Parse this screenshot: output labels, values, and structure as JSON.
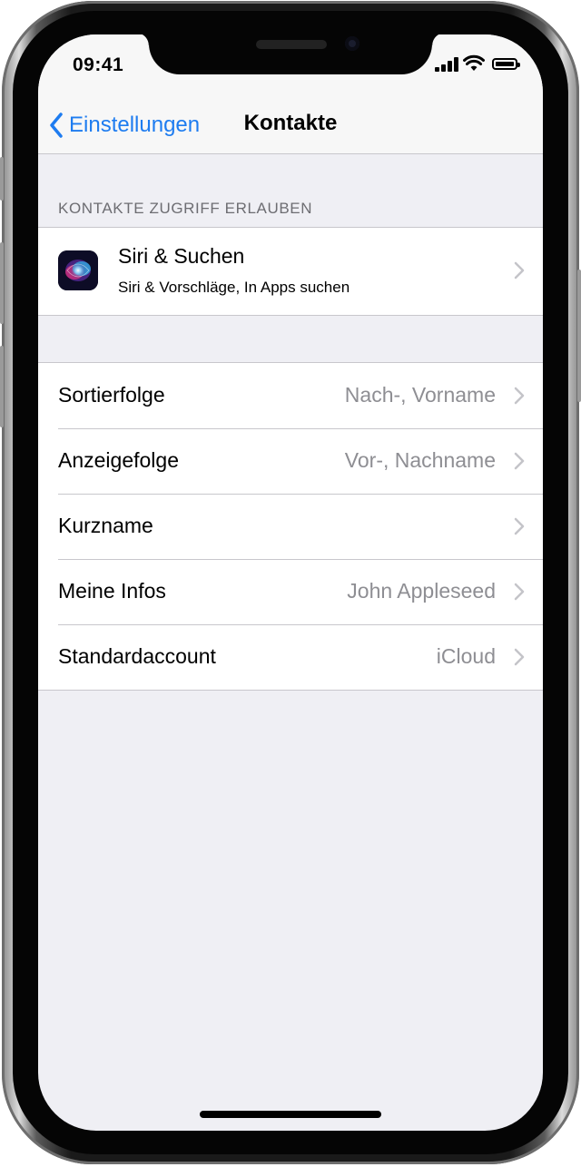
{
  "status_bar": {
    "time": "09:41"
  },
  "nav": {
    "back_label": "Einstellungen",
    "title": "Kontakte"
  },
  "section_header": "KONTAKTE ZUGRIFF ERLAUBEN",
  "siri_row": {
    "title": "Siri & Suchen",
    "subtitle": "Siri & Vorschläge, In Apps suchen",
    "icon": "siri-icon"
  },
  "settings": [
    {
      "label": "Sortierfolge",
      "value": "Nach-, Vorname"
    },
    {
      "label": "Anzeigefolge",
      "value": "Vor-, Nachname"
    },
    {
      "label": "Kurzname",
      "value": ""
    },
    {
      "label": "Meine Infos",
      "value": "John Appleseed"
    },
    {
      "label": "Standardaccount",
      "value": "iCloud"
    }
  ],
  "colors": {
    "accent": "#1e7cf0",
    "background": "#efeff4",
    "secondary_text": "#8e8e93"
  }
}
